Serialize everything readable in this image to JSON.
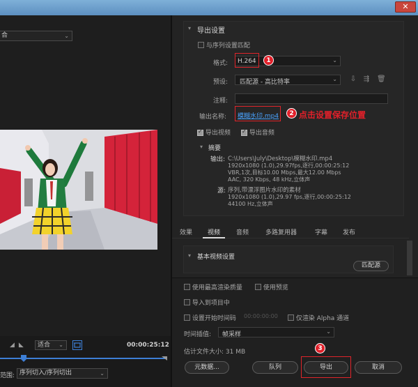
{
  "window": {
    "close_glyph": "✕"
  },
  "left": {
    "source_select": "合",
    "fit_select": "适合",
    "timecode": "00:00:25:12",
    "range_label": "范围:",
    "range_select": "序列切入/序列切出"
  },
  "export": {
    "section_title": "导出设置",
    "match_sequence": "与序列设置匹配",
    "format_label": "格式:",
    "format_value": "H.264",
    "preset_label": "预设:",
    "preset_value": "匹配源 - 高比特率",
    "comment_label": "注释:",
    "output_label": "输出名称:",
    "output_value": "模糊水印.mp4",
    "export_video": "导出视频",
    "export_audio": "导出音频",
    "summary_title": "摘要",
    "output_heading": "输出:",
    "output_path": "C:\\Users\\July\\Desktop\\模糊水印.mp4",
    "output_line2": "1920x1080 (1.0),29.97fps,逐行,00:00:25:12",
    "output_line3": "VBR,1次,目标10.00 Mbps,最大12.00 Mbps",
    "output_line4": "AAC, 320 Kbps, 48 kHz,立体声",
    "source_heading": "源:",
    "source_line1": "序列,带漂浮图片水印的素材",
    "source_line2": "1920x1080 (1.0),29.97 fps,逐行,00:00:25:12",
    "source_line3": "44100 Hz,立体声"
  },
  "annotations": {
    "m1": "1",
    "m2": "2",
    "m2_text": "点击设置保存位置",
    "m3": "3"
  },
  "tabs": [
    "效果",
    "视频",
    "音频",
    "多路复用器",
    "字幕",
    "发布"
  ],
  "video_settings": {
    "title": "基本视频设置",
    "match_source_button": "匹配源"
  },
  "bottom": {
    "max_render_quality": "使用最高渲染质量",
    "use_previews": "使用预览",
    "import_to_project": "导入到项目中",
    "set_start_timecode": "设置开始时间码",
    "start_timecode_value": "00:00:00:00",
    "render_alpha_only": "仅渲染 Alpha 通道",
    "time_interp_label": "时间插值:",
    "time_interp_value": "帧采样",
    "est_file_size": "估计文件大小: 31 MB",
    "metadata_button": "元数据...",
    "queue_button": "队列",
    "export_button": "导出",
    "cancel_button": "取消"
  },
  "colors": {
    "accent": "#3d7fd6",
    "annotation_red": "#e1202a",
    "link": "#4aa3ff"
  }
}
